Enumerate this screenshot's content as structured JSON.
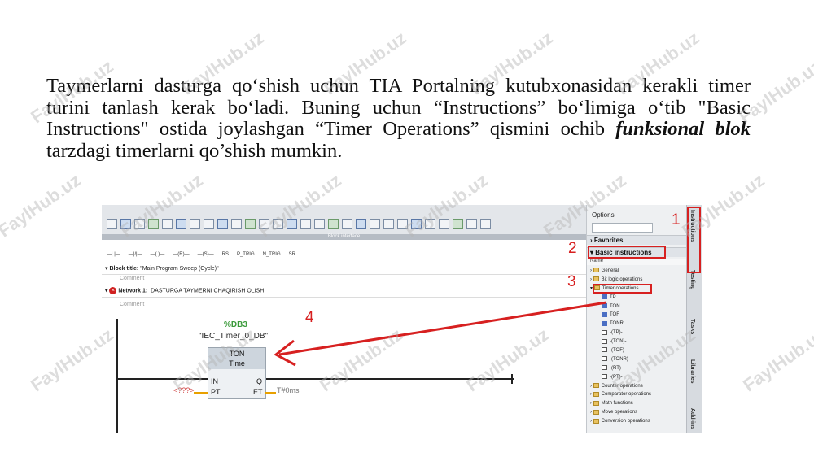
{
  "paragraph": {
    "part1": "Taymerlarni dasturga qo‘shish uchun TIA Portalning kutubxonasidan kerakli timer turini tanlash kerak bo‘ladi. Buning uchun “Instructions” bo‘limiga o‘tib \"Basic Instructions\" ostida joylashgan “Timer Operations” qismini ochib ",
    "emphasis": "funksional blok",
    "part2": " tarzdagi timerlarni qo’shish mumkin."
  },
  "watermark": "FaylHub.uz",
  "editor": {
    "block_interface": "Block interface",
    "toolbar2": [
      "—| |—",
      "—|/|—",
      "—( )—",
      "—(R)—",
      "—(S)—",
      "RS",
      "P_TRIG",
      "N_TRIG",
      "SR"
    ],
    "block_title_label": "Block title:",
    "block_title_value": "\"Main Program Sweep (Cycle)\"",
    "comment": "Comment",
    "network_label": "Network 1:",
    "network_title": "DASTURGA TAYMERNI CHAQIRISH OLISH",
    "network_comment": "Comment"
  },
  "timer_block": {
    "db": "%DB3",
    "instance": "\"IEC_Timer_0_DB\"",
    "type": "TON",
    "subtitle": "Time",
    "pin_in": "IN",
    "pin_pt": "PT",
    "pin_q": "Q",
    "pin_et": "ET",
    "pt_value": "<???>",
    "et_value": "T#0ms"
  },
  "options_panel": {
    "title": "Options",
    "favorites": "Favorites",
    "basic_instructions": "Basic instructions",
    "name_header": "Name",
    "tree": [
      {
        "label": "General",
        "icon": "folder-icon",
        "indent": 1
      },
      {
        "label": "Bit logic operations",
        "icon": "folder-icon",
        "indent": 1
      },
      {
        "label": "Timer operations",
        "icon": "timer-folder-icon",
        "indent": 1
      },
      {
        "label": "TP",
        "icon": "block-icon",
        "indent": 2
      },
      {
        "label": "TON",
        "icon": "block-icon",
        "indent": 2
      },
      {
        "label": "TOF",
        "icon": "block-icon",
        "indent": 2
      },
      {
        "label": "TONR",
        "icon": "block-icon",
        "indent": 2
      },
      {
        "label": "-(TP)-",
        "icon": "coil-icon",
        "indent": 2
      },
      {
        "label": "-(TON)-",
        "icon": "coil-icon",
        "indent": 2
      },
      {
        "label": "-(TOF)-",
        "icon": "coil-icon",
        "indent": 2
      },
      {
        "label": "-(TONR)-",
        "icon": "coil-icon",
        "indent": 2
      },
      {
        "label": "-(RT)-",
        "icon": "coil-icon",
        "indent": 2
      },
      {
        "label": "-(PT)-",
        "icon": "coil-icon",
        "indent": 2
      },
      {
        "label": "Counter operations",
        "icon": "folder-icon",
        "indent": 1
      },
      {
        "label": "Comparator operations",
        "icon": "folder-icon",
        "indent": 1
      },
      {
        "label": "Math functions",
        "icon": "folder-icon",
        "indent": 1
      },
      {
        "label": "Move operations",
        "icon": "folder-icon",
        "indent": 1
      },
      {
        "label": "Conversion operations",
        "icon": "folder-icon",
        "indent": 1
      }
    ],
    "vertical_tabs": [
      "Instructions",
      "Testing",
      "Tasks",
      "Libraries",
      "Add-ins"
    ]
  },
  "annotations": [
    "1",
    "2",
    "3",
    "4"
  ],
  "colors": {
    "annotation_red": "#d72020",
    "db_green": "#3a9a3a",
    "wire_orange": "#e8a000"
  }
}
